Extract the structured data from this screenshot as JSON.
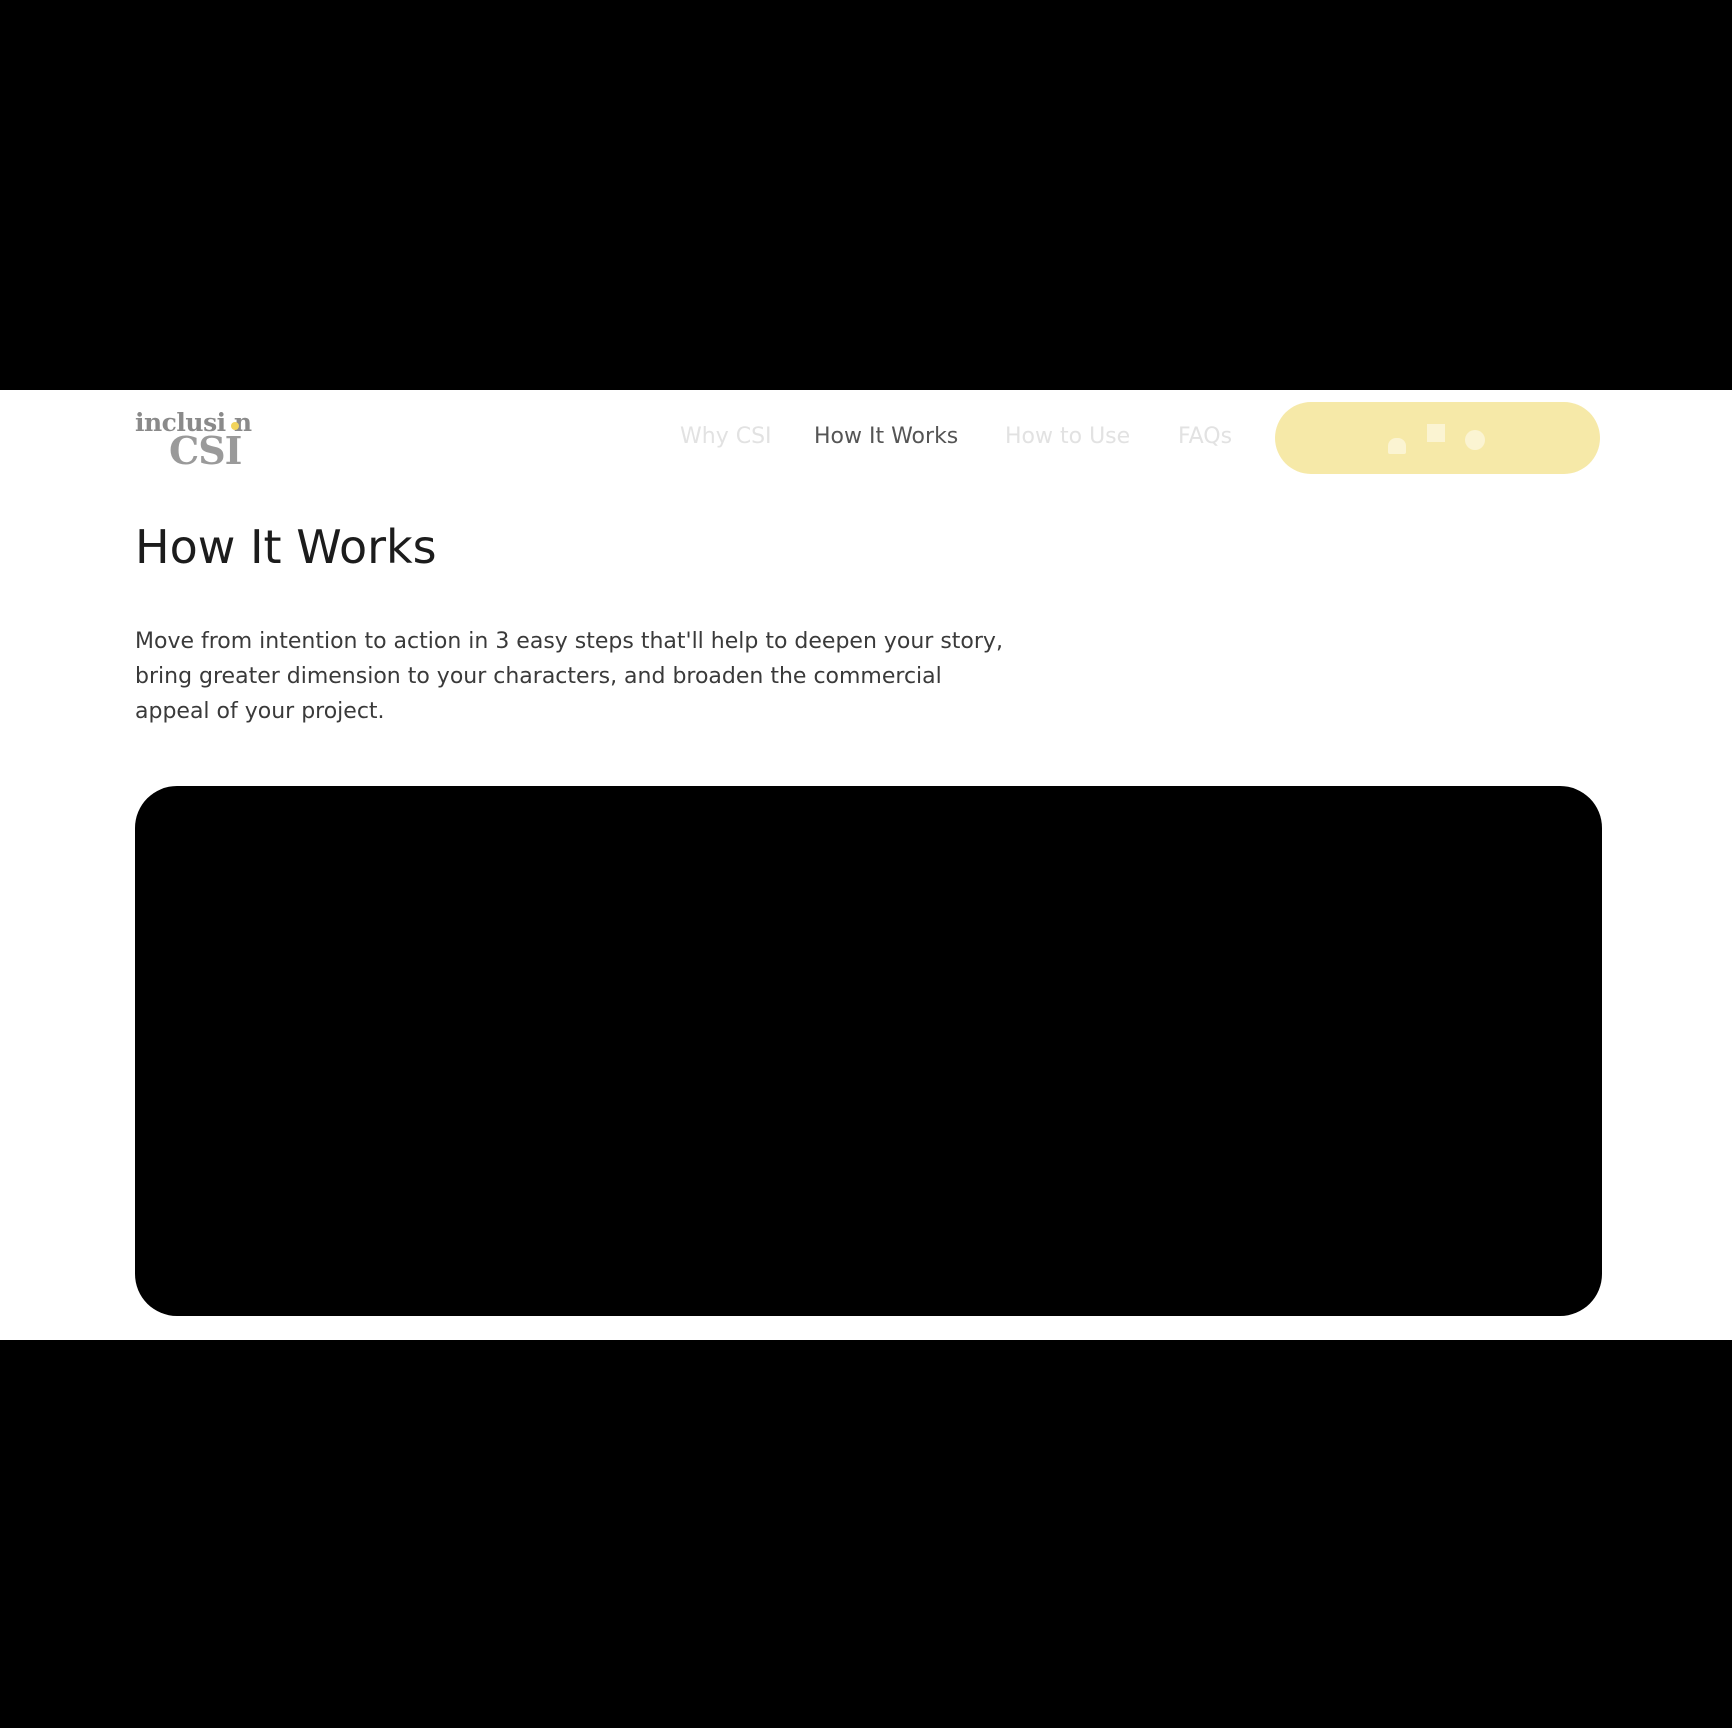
{
  "logo": {
    "word": "inclusi n",
    "mark": "CSI"
  },
  "nav": {
    "items": [
      {
        "label": "Why CSI",
        "active": false
      },
      {
        "label": "How It Works",
        "active": true
      },
      {
        "label": "How to Use",
        "active": false
      },
      {
        "label": "FAQs",
        "active": false
      }
    ]
  },
  "cta": {
    "icons": [
      "house-icon",
      "square-icon",
      "circle-icon"
    ],
    "color": "#f6e9a8"
  },
  "main": {
    "title": "How It Works",
    "intro": "Move from intention to action in 3 easy steps that'll help to deepen your story, bring greater dimension to your characters, and broaden the commercial appeal of your project."
  },
  "colors": {
    "background": "#ffffff",
    "letterbox": "#000000",
    "accent": "#f2d45c"
  }
}
